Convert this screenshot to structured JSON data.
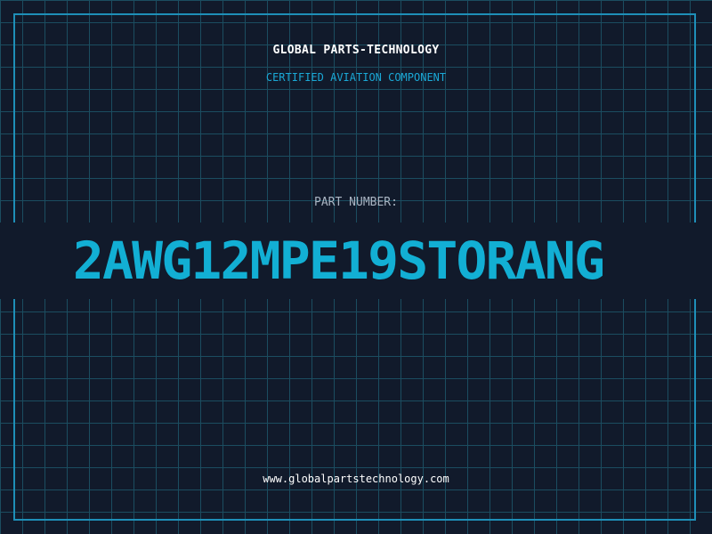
{
  "header": {
    "company": "GLOBAL PARTS-TECHNOLOGY",
    "certification": "CERTIFIED AVIATION COMPONENT"
  },
  "part": {
    "label": "PART NUMBER:",
    "number": "2AWG12MPE19STORANG"
  },
  "footer": {
    "url": "www.globalpartstechnology.com"
  },
  "colors": {
    "background": "#111a2b",
    "grid": "#1b4d60",
    "accent": "#12afd4",
    "frame": "#1e8fb8"
  }
}
